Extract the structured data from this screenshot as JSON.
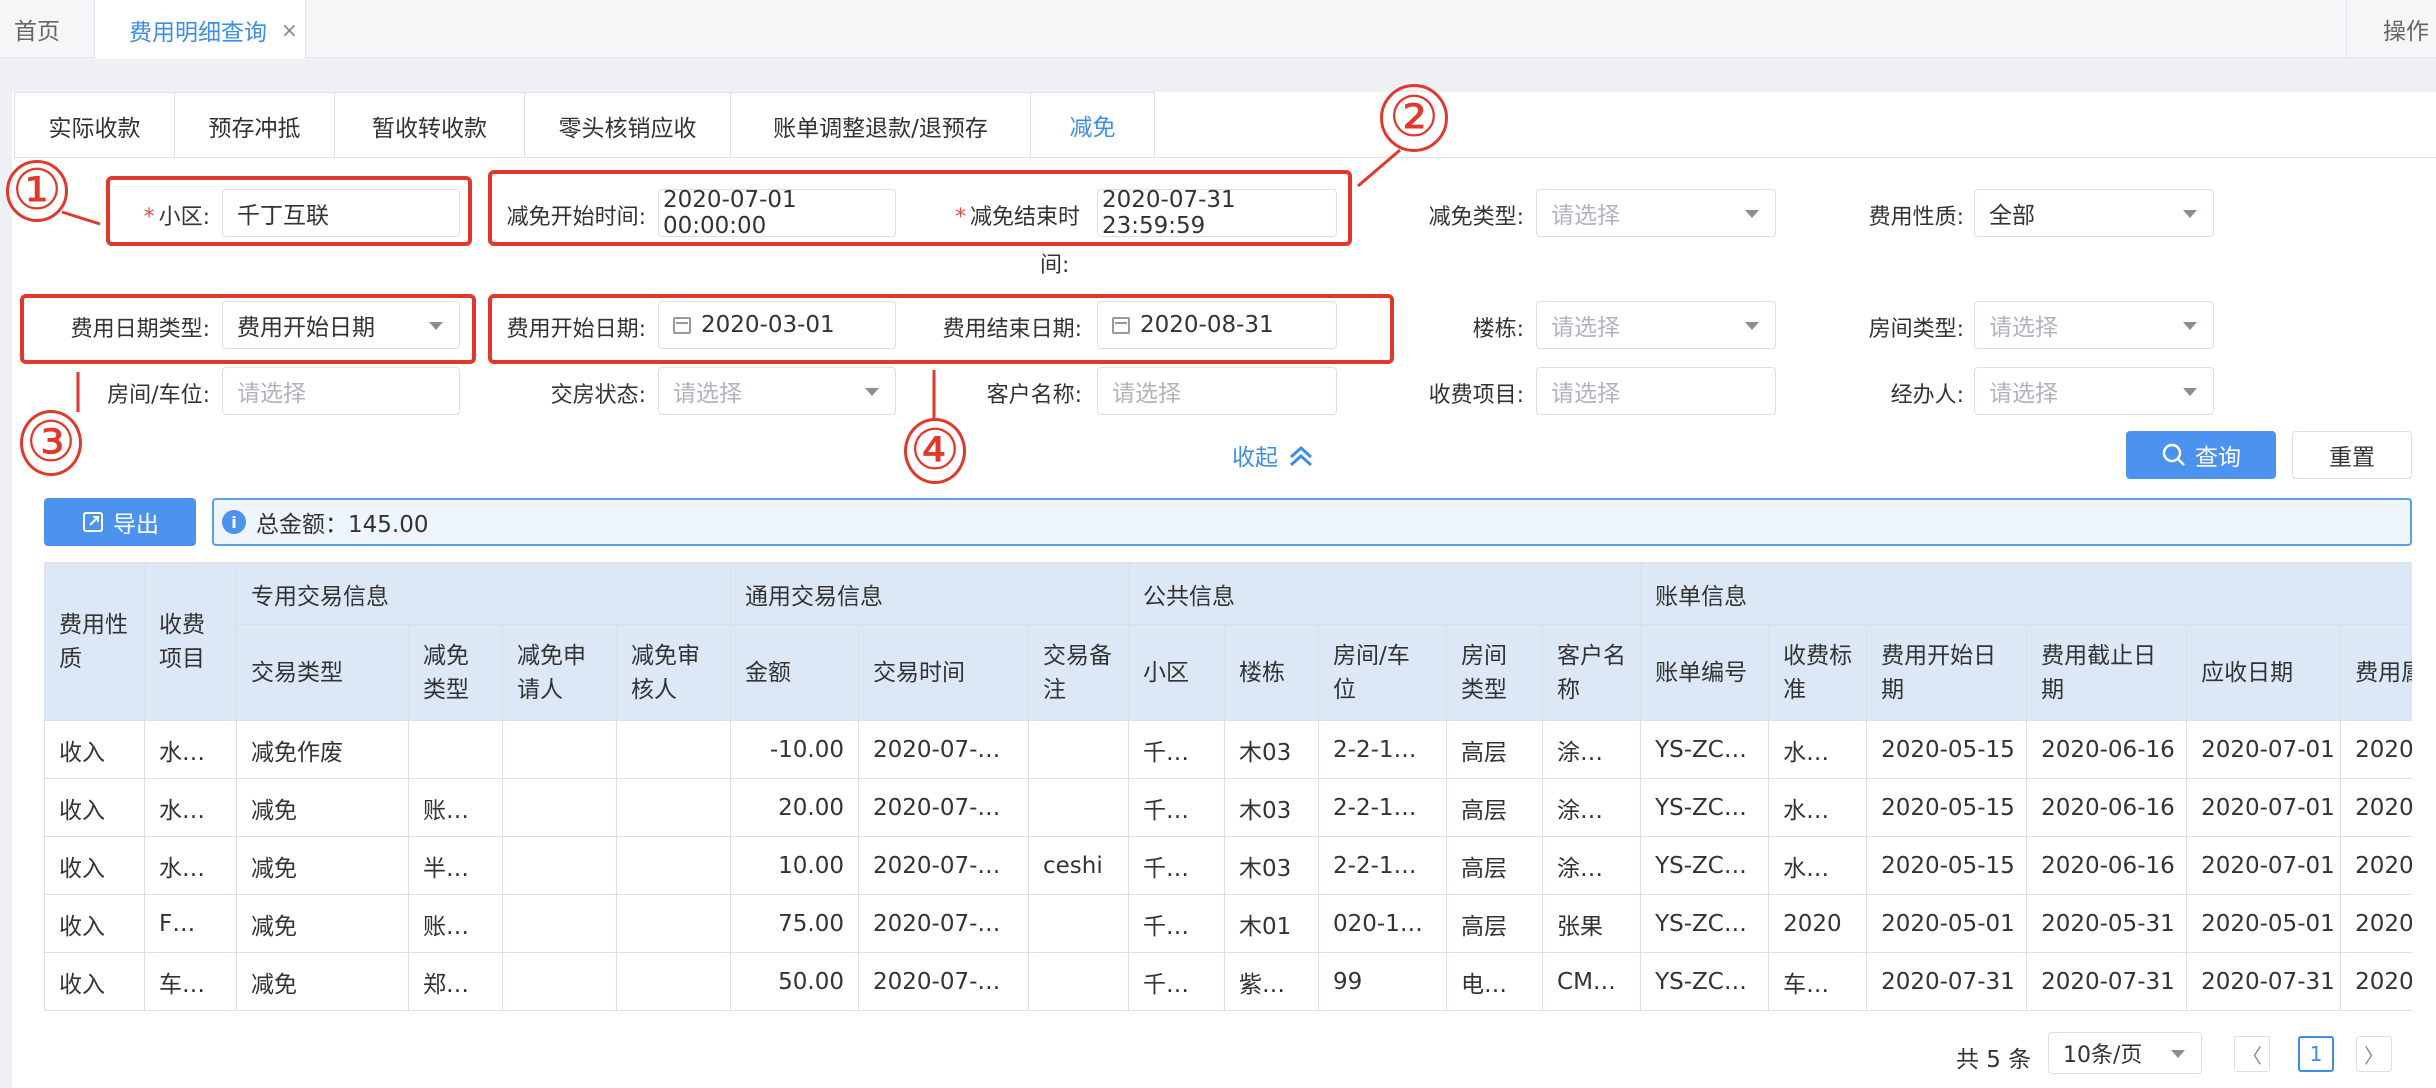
{
  "top_tabs": {
    "home": "首页",
    "active": "费用明细查询",
    "close": "×",
    "right": "操作"
  },
  "sub_tabs": [
    "实际收款",
    "预存冲抵",
    "暂收转收款",
    "零头核销应收",
    "账单调整退款/退预存",
    "减免"
  ],
  "form": {
    "community_label": "小区:",
    "community_value": "千丁互联",
    "required_mark": "*",
    "waive_start_label": "减免开始时间:",
    "waive_start_value": "2020-07-01 00:00:00",
    "waive_end_label": "减免结束时",
    "waive_end_label_wrap": "间:",
    "waive_end_value": "2020-07-31 23:59:59",
    "waive_type_label": "减免类型:",
    "fee_nature_label": "费用性质:",
    "fee_nature_value": "全部",
    "date_type_label": "费用日期类型:",
    "date_type_value": "费用开始日期",
    "fee_start_label": "费用开始日期:",
    "fee_start_value": "2020-03-01",
    "fee_end_label": "费用结束日期:",
    "fee_end_value": "2020-08-31",
    "building_label": "楼栋:",
    "room_type_label": "房间类型:",
    "room_label": "房间/车位:",
    "handover_label": "交房状态:",
    "customer_label": "客户名称:",
    "charge_item_label": "收费项目:",
    "handler_label": "经办人:",
    "placeholder_select": "请选择",
    "collapse": "收起"
  },
  "annotations": [
    "①",
    "②",
    "③",
    "④"
  ],
  "buttons": {
    "query": "查询",
    "reset": "重置",
    "export": "导出"
  },
  "summary": "总金额：145.00",
  "table": {
    "group_headers": {
      "nature": "费用性质",
      "item": "收费项目",
      "special": "专用交易信息",
      "general": "通用交易信息",
      "public": "公共信息",
      "bill": "账单信息"
    },
    "sub_headers": [
      "交易类型",
      "减免类型",
      "减免申请人",
      "减免审核人",
      "金额",
      "交易时间",
      "交易备注",
      "小区",
      "楼栋",
      "房间/车位",
      "房间类型",
      "客户名称",
      "账单编号",
      "收费标准",
      "费用开始日期",
      "费用截止日期",
      "应收日期",
      "费用属月"
    ],
    "rows": [
      [
        "收入",
        "水…",
        "减免作废",
        "",
        "",
        "",
        "-10.00",
        "2020-07-…",
        "",
        "千…",
        "木03",
        "2-2-1…",
        "高层",
        "涂…",
        "YS-ZC…",
        "水…",
        "2020-05-15",
        "2020-06-16",
        "2020-07-01",
        "2020"
      ],
      [
        "收入",
        "水…",
        "减免",
        "账…",
        "",
        "",
        "20.00",
        "2020-07-…",
        "",
        "千…",
        "木03",
        "2-2-1…",
        "高层",
        "涂…",
        "YS-ZC…",
        "水…",
        "2020-05-15",
        "2020-06-16",
        "2020-07-01",
        "2020"
      ],
      [
        "收入",
        "水…",
        "减免",
        "半…",
        "",
        "",
        "10.00",
        "2020-07-…",
        "ceshi",
        "千…",
        "木03",
        "2-2-1…",
        "高层",
        "涂…",
        "YS-ZC…",
        "水…",
        "2020-05-15",
        "2020-06-16",
        "2020-07-01",
        "2020"
      ],
      [
        "收入",
        "F…",
        "减免",
        "账…",
        "",
        "",
        "75.00",
        "2020-07-…",
        "",
        "千…",
        "木01",
        "020-1…",
        "高层",
        "张果",
        "YS-ZC…",
        "2020",
        "2020-05-01",
        "2020-05-31",
        "2020-05-01",
        "2020"
      ],
      [
        "收入",
        "车…",
        "减免",
        "郑…",
        "",
        "",
        "50.00",
        "2020-07-…",
        "",
        "千…",
        "紫…",
        "99",
        "电…",
        "CM…",
        "YS-ZC…",
        "车…",
        "2020-07-31",
        "2020-07-31",
        "2020-07-31",
        "2020"
      ]
    ]
  },
  "pagination": {
    "total": "共 5 条",
    "page_size": "10条/页",
    "prev": "〈",
    "current": "1",
    "next": "〉"
  }
}
